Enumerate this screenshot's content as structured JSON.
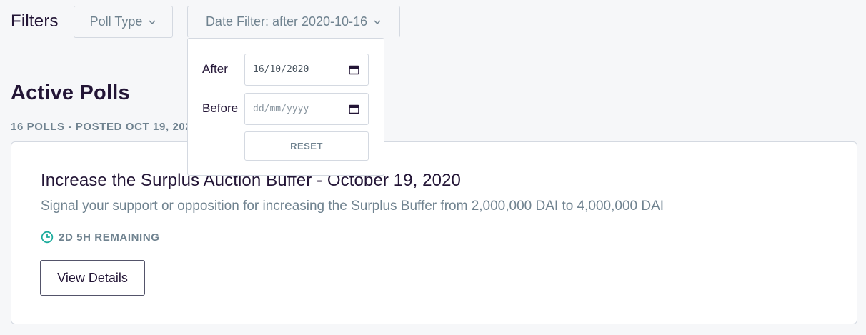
{
  "filters": {
    "label": "Filters",
    "poll_type_label": "Poll Type",
    "date_filter_label": "Date Filter: after 2020-10-16"
  },
  "date_popover": {
    "after_label": "After",
    "after_value": "16/10/2020",
    "before_label": "Before",
    "before_placeholder": "dd/mm/yyyy",
    "reset_label": "RESET"
  },
  "active_polls": {
    "title": "Active Polls",
    "meta": "16 POLLS - POSTED OCT 19, 2020"
  },
  "poll": {
    "title": "Increase the Surplus Auction Buffer - October 19, 2020",
    "description": "Signal your support or opposition for increasing the Surplus Buffer from 2,000,000 DAI to 4,000,000 DAI",
    "remaining": "2D 5H REMAINING",
    "view_details_label": "View Details"
  },
  "icons": {
    "chevron": "chevron-down-icon",
    "calendar": "calendar-icon",
    "clock": "clock-icon"
  },
  "colors": {
    "accent_teal": "#1aab9b",
    "text_primary": "#231536",
    "text_muted": "#708390",
    "border": "#d4d9e1",
    "background": "#f6f7f9"
  }
}
